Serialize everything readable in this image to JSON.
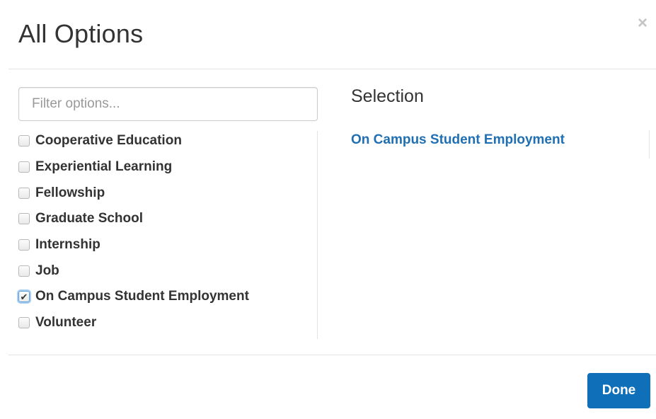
{
  "modal": {
    "title": "All Options",
    "close_glyph": "×",
    "close_icon": "close-icon"
  },
  "filter": {
    "placeholder": "Filter options...",
    "value": ""
  },
  "options": [
    {
      "label": "Cooperative Education",
      "checked": false
    },
    {
      "label": "Experiential Learning",
      "checked": false
    },
    {
      "label": "Fellowship",
      "checked": false
    },
    {
      "label": "Graduate School",
      "checked": false
    },
    {
      "label": "Internship",
      "checked": false
    },
    {
      "label": "Job",
      "checked": false
    },
    {
      "label": "On Campus Student Employment",
      "checked": true
    },
    {
      "label": "Volunteer",
      "checked": false
    }
  ],
  "selection": {
    "heading": "Selection",
    "items": [
      "On Campus Student Employment"
    ]
  },
  "footer": {
    "done_label": "Done"
  },
  "colors": {
    "accent": "#0f6fb8",
    "link": "#1f6fb2",
    "text": "#333333",
    "divider": "#e3e3e3"
  }
}
